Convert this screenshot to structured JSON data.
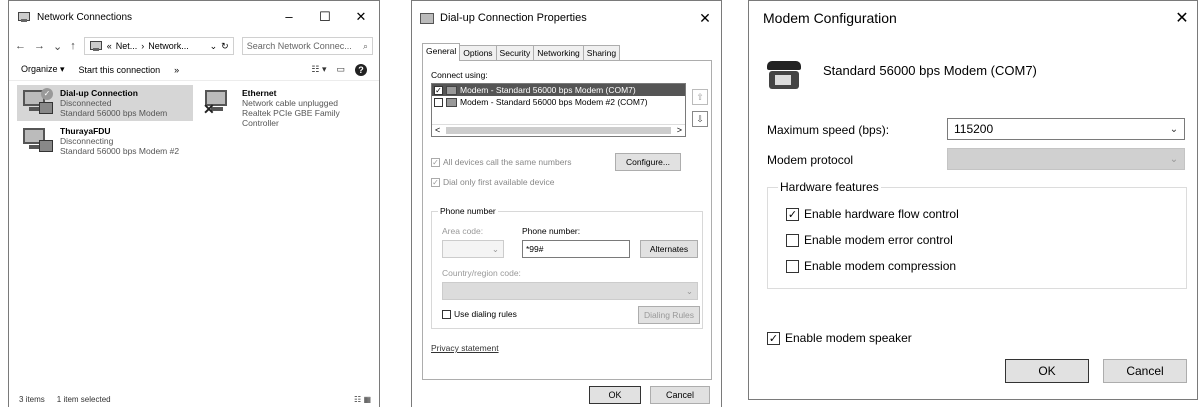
{
  "network_connections": {
    "title": "Network Connections",
    "window_controls": {
      "minimize": "–",
      "maximize": "☐",
      "close": "✕"
    },
    "nav": {
      "back": "←",
      "forward": "→",
      "dropdown": "⌄",
      "up": "↑"
    },
    "breadcrumb": {
      "prefix": "«",
      "part1": "Net...",
      "separator": "›",
      "part2": "Network...",
      "dropdown": "⌄",
      "refresh": "↻"
    },
    "search_placeholder": "Search Network Connec...",
    "search_icon_glyph": "⌕",
    "toolbar": {
      "organize": "Organize ▾",
      "start_connection": "Start this connection",
      "more": "»",
      "view": "☷ ▾",
      "pane": "▭",
      "help": "?"
    },
    "connections": [
      {
        "name": "Dial-up Connection",
        "status": "Disconnected",
        "device": "Standard 56000 bps Modem",
        "selected": true
      },
      {
        "name": "Ethernet",
        "status": "Network cable unplugged",
        "device": "Realtek PCIe GBE Family Controller",
        "selected": false
      },
      {
        "name": "ThurayaFDU",
        "status": "Disconnecting",
        "device": "Standard 56000 bps Modem #2",
        "selected": false
      }
    ],
    "status_bar": {
      "item_count": "3 items",
      "selected_count": "1 item selected",
      "view_icons": "☷ ▦"
    }
  },
  "dialup_properties": {
    "title": "Dial-up Connection Properties",
    "close_glyph": "✕",
    "tabs": [
      "General",
      "Options",
      "Security",
      "Networking",
      "Sharing"
    ],
    "active_tab": 0,
    "connect_using_label": "Connect using:",
    "devices": [
      {
        "label": "Modem - Standard 56000 bps Modem (COM7)",
        "checked": true,
        "selected": true
      },
      {
        "label": "Modem - Standard 56000 bps Modem #2 (COM7)",
        "checked": false,
        "selected": false
      }
    ],
    "scroll_left": "<",
    "scroll_right": ">",
    "move_up_glyph": "⇧",
    "move_down_glyph": "⇩",
    "all_devices_label": "All devices call the same numbers",
    "dial_first_label": "Dial only first available device",
    "configure_button": "Configure...",
    "phone_group_label": "Phone number",
    "area_code_label": "Area code:",
    "phone_number_label": "Phone number:",
    "phone_number_value": "*99#",
    "alternates_button": "Alternates",
    "country_label": "Country/region code:",
    "dropdown_glyph": "⌄",
    "use_dialing_rules_label": "Use dialing rules",
    "dialing_rules_button": "Dialing Rules",
    "privacy_link": "Privacy statement",
    "ok_button": "OK",
    "cancel_button": "Cancel"
  },
  "modem_config": {
    "title": "Modem Configuration",
    "close_glyph": "✕",
    "modem_name": "Standard 56000 bps Modem (COM7)",
    "max_speed_label": "Maximum speed (bps):",
    "max_speed_value": "115200",
    "dropdown_glyph": "⌄",
    "protocol_label": "Modem protocol",
    "protocol_value": "",
    "hardware_group_label": "Hardware features",
    "hw_flow_label": "Enable hardware flow control",
    "hw_flow_checked": true,
    "error_control_label": "Enable modem error control",
    "error_control_checked": false,
    "compression_label": "Enable modem compression",
    "compression_checked": false,
    "speaker_label": "Enable modem speaker",
    "speaker_checked": true,
    "ok_button": "OK",
    "cancel_button": "Cancel"
  },
  "icons": [
    "network-icon",
    "modem-icon",
    "ethernet-icon",
    "phone-icon",
    "search-icon",
    "help-icon"
  ],
  "colors": {
    "selection": "#d6d6d6",
    "list-selection": "#555555",
    "button": "#e1e1e1",
    "border": "#7a7a7a"
  }
}
